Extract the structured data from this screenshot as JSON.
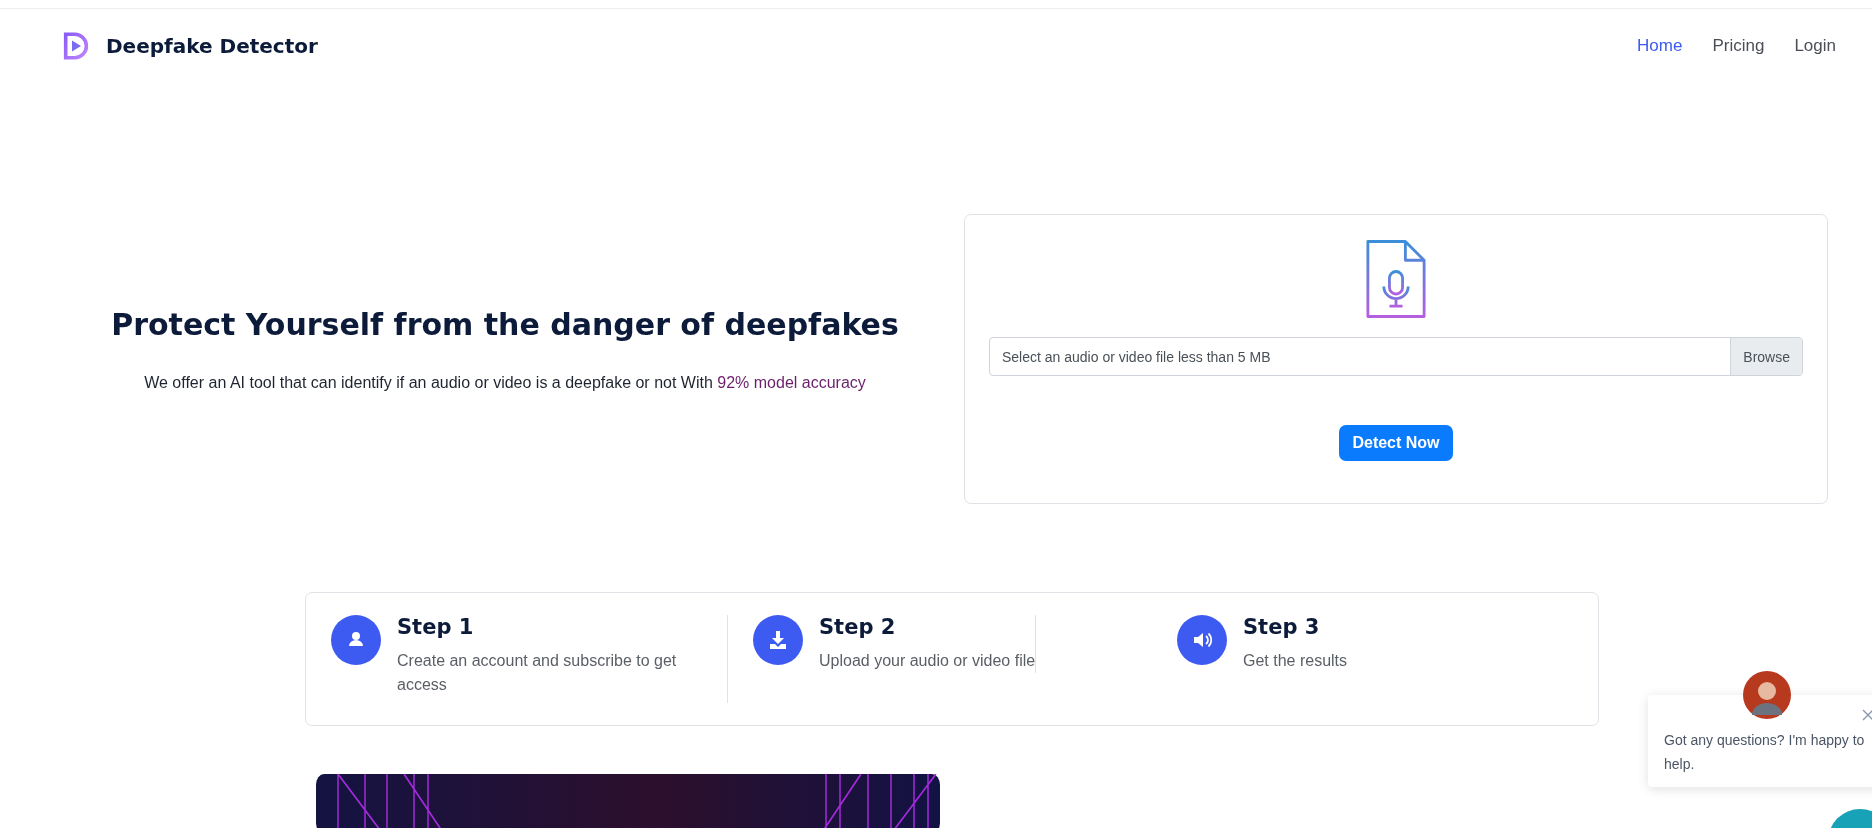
{
  "header": {
    "brand": "Deepfake Detector",
    "nav": [
      {
        "label": "Home",
        "selected": true
      },
      {
        "label": "Pricing",
        "selected": false
      },
      {
        "label": "Login",
        "selected": false
      }
    ]
  },
  "hero": {
    "title": "Protect Yourself from the danger of deepfakes",
    "subtitle": "We offer an AI tool that can identify if an audio or video is a deepfake or not With",
    "highlight": "92% model accuracy"
  },
  "upload": {
    "placeholder": "Select an audio or video file less than 5 MB",
    "browse": "Browse",
    "submit": "Detect Now"
  },
  "steps": [
    {
      "kind": "user",
      "title": "Step 1",
      "text": "Create an account and subscribe to get access"
    },
    {
      "kind": "download",
      "title": "Step 2",
      "text": "Upload your audio or video file"
    },
    {
      "kind": "sound",
      "title": "Step 3",
      "text": "Get the results"
    }
  ],
  "chat": {
    "message": "Got any questions? I'm happy to help."
  }
}
